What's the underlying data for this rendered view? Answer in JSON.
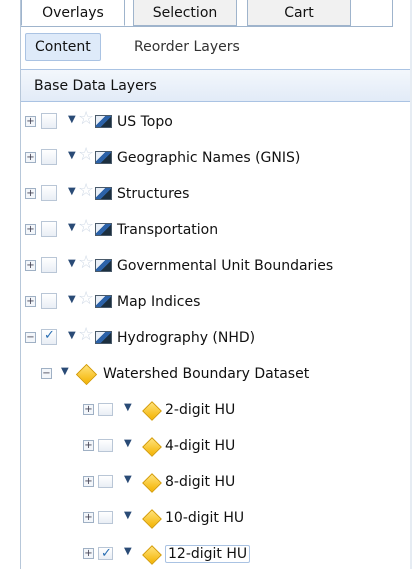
{
  "tabs": [
    "Overlays",
    "Selection",
    "Cart"
  ],
  "subtabs": [
    "Content",
    "Reorder Layers"
  ],
  "panel_header": "Base Data Layers",
  "layers": [
    {
      "label": "US Topo",
      "checked": false
    },
    {
      "label": "Geographic Names (GNIS)",
      "checked": false
    },
    {
      "label": "Structures",
      "checked": false
    },
    {
      "label": "Transportation",
      "checked": false
    },
    {
      "label": "Governmental Unit Boundaries",
      "checked": false
    },
    {
      "label": "Map Indices",
      "checked": false
    },
    {
      "label": "Hydrography (NHD)",
      "checked": true
    }
  ],
  "watershed": {
    "label": "Watershed Boundary Dataset"
  },
  "hu_layers": [
    {
      "label": "2-digit HU",
      "checked": false
    },
    {
      "label": "4-digit HU",
      "checked": false
    },
    {
      "label": "8-digit HU",
      "checked": false
    },
    {
      "label": "10-digit HU",
      "checked": false
    },
    {
      "label": "12-digit HU",
      "checked": true
    }
  ],
  "icons": {
    "expand": "+",
    "collapse": "−",
    "arrow": "▼",
    "star": "☆",
    "check": "✓"
  }
}
